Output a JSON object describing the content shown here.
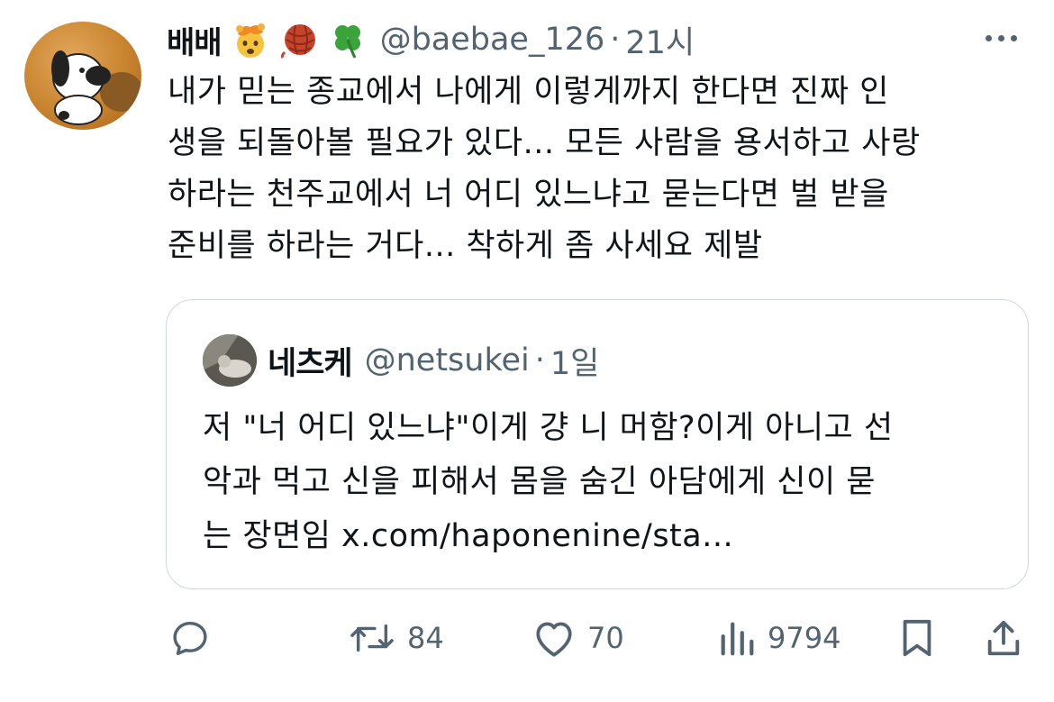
{
  "tweet": {
    "display_name": "배배",
    "name_emojis": [
      "exploding-head-emoji",
      "yarn-emoji",
      "four-leaf-clover-emoji"
    ],
    "handle": "@baebae_126",
    "separator": "·",
    "time": "21시",
    "text_lines": [
      "내가 믿는 종교에서 나에게 이렇게까지 한다면 진짜 인",
      "생을 되돌아볼 필요가 있다... 모든 사람을 용서하고 사랑",
      "하라는 천주교에서 너 어디 있느냐고 묻는다면 벌 받을",
      "준비를 하라는 거다... 착하게 좀 사세요 제발"
    ]
  },
  "quote": {
    "display_name": "네츠케",
    "handle": "@netsukei",
    "separator": "·",
    "time": "1일",
    "text_lines": [
      "저 \"너 어디 있느냐\"이게 걍 니 머함?이게 아니고 선",
      "악과 먹고 신을 피해서 몸을 숨긴 아담에게 신이 묻",
      "는 장면임 x.com/haponenine/sta..."
    ]
  },
  "actions": {
    "reply_icon": "reply-icon",
    "retweet_count": "84",
    "like_count": "70",
    "views_count": "9794",
    "bookmark_icon": "bookmark-icon",
    "share_icon": "share-icon"
  },
  "colors": {
    "text": "#0f1419",
    "secondary": "#536471",
    "border": "#cfd9de",
    "background": "#ffffff"
  }
}
